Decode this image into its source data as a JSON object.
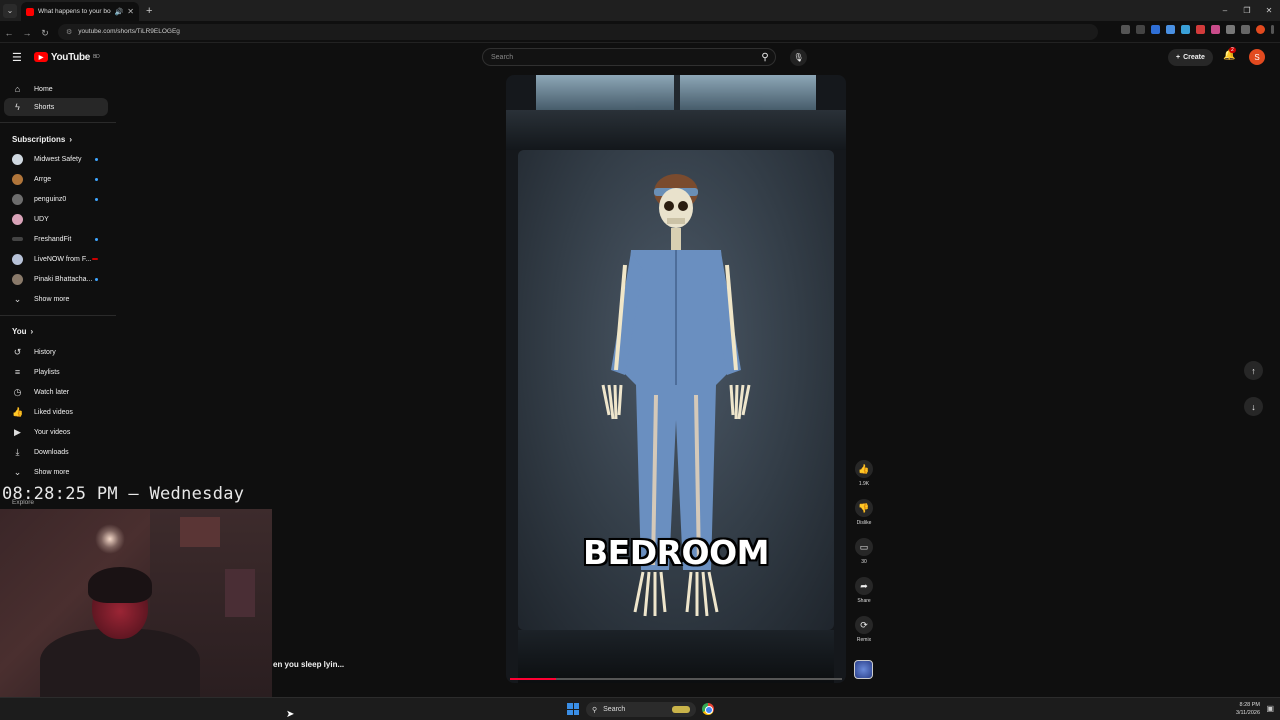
{
  "browser": {
    "tab_title": "What happens to your bod",
    "new_tab": "+",
    "url": "youtube.com/shorts/TiLR9ELOGEg",
    "window_controls": [
      "–",
      "❐",
      "✕"
    ]
  },
  "header": {
    "logo_text": "YouTube",
    "logo_sup": "BD",
    "search_placeholder": "Search",
    "create_label": "Create",
    "notification_count": "2",
    "avatar_letter": "S"
  },
  "sidebar": {
    "main": [
      {
        "label": "Home",
        "icon": "home-icon"
      },
      {
        "label": "Shorts",
        "icon": "shorts-icon"
      }
    ],
    "subscriptions_title": "Subscriptions",
    "subscriptions": [
      {
        "label": "Midwest Safety",
        "color": "#cfd8e0"
      },
      {
        "label": "Arrge",
        "color": "#b0753a"
      },
      {
        "label": "penguinz0",
        "color": "#6d6d6d"
      },
      {
        "label": "UDY",
        "color": "#d9a3b8"
      },
      {
        "label": "FreshandFit",
        "color": "#444444"
      },
      {
        "label": "LiveNOW from F...",
        "color": "#b7c2d8"
      },
      {
        "label": "Pinaki Bhattacha...",
        "color": "#8a7a6a"
      }
    ],
    "show_more": "Show more",
    "you_title": "You",
    "you": [
      {
        "label": "History",
        "icon": "history-icon"
      },
      {
        "label": "Playlists",
        "icon": "playlists-icon"
      },
      {
        "label": "Watch later",
        "icon": "watch-later-icon"
      },
      {
        "label": "Liked videos",
        "icon": "liked-videos-icon"
      },
      {
        "label": "Your videos",
        "icon": "your-videos-icon"
      },
      {
        "label": "Downloads",
        "icon": "downloads-icon"
      }
    ],
    "show_more_2": "Show more",
    "explore": "Explore"
  },
  "overlay": {
    "clock": "08:28:25 PM – Wednesday",
    "caption": "en you sleep lyin..."
  },
  "video": {
    "overlay_text": "BEDROOM",
    "progress_percent": 14
  },
  "actions": {
    "like_count": "1.9K",
    "dislike_label": "Dislike",
    "comment_count": "30",
    "share_label": "Share",
    "remix_label": "Remix"
  },
  "taskbar": {
    "search_label": "Search",
    "time": "8:28 PM",
    "date": "3/11/2026"
  }
}
